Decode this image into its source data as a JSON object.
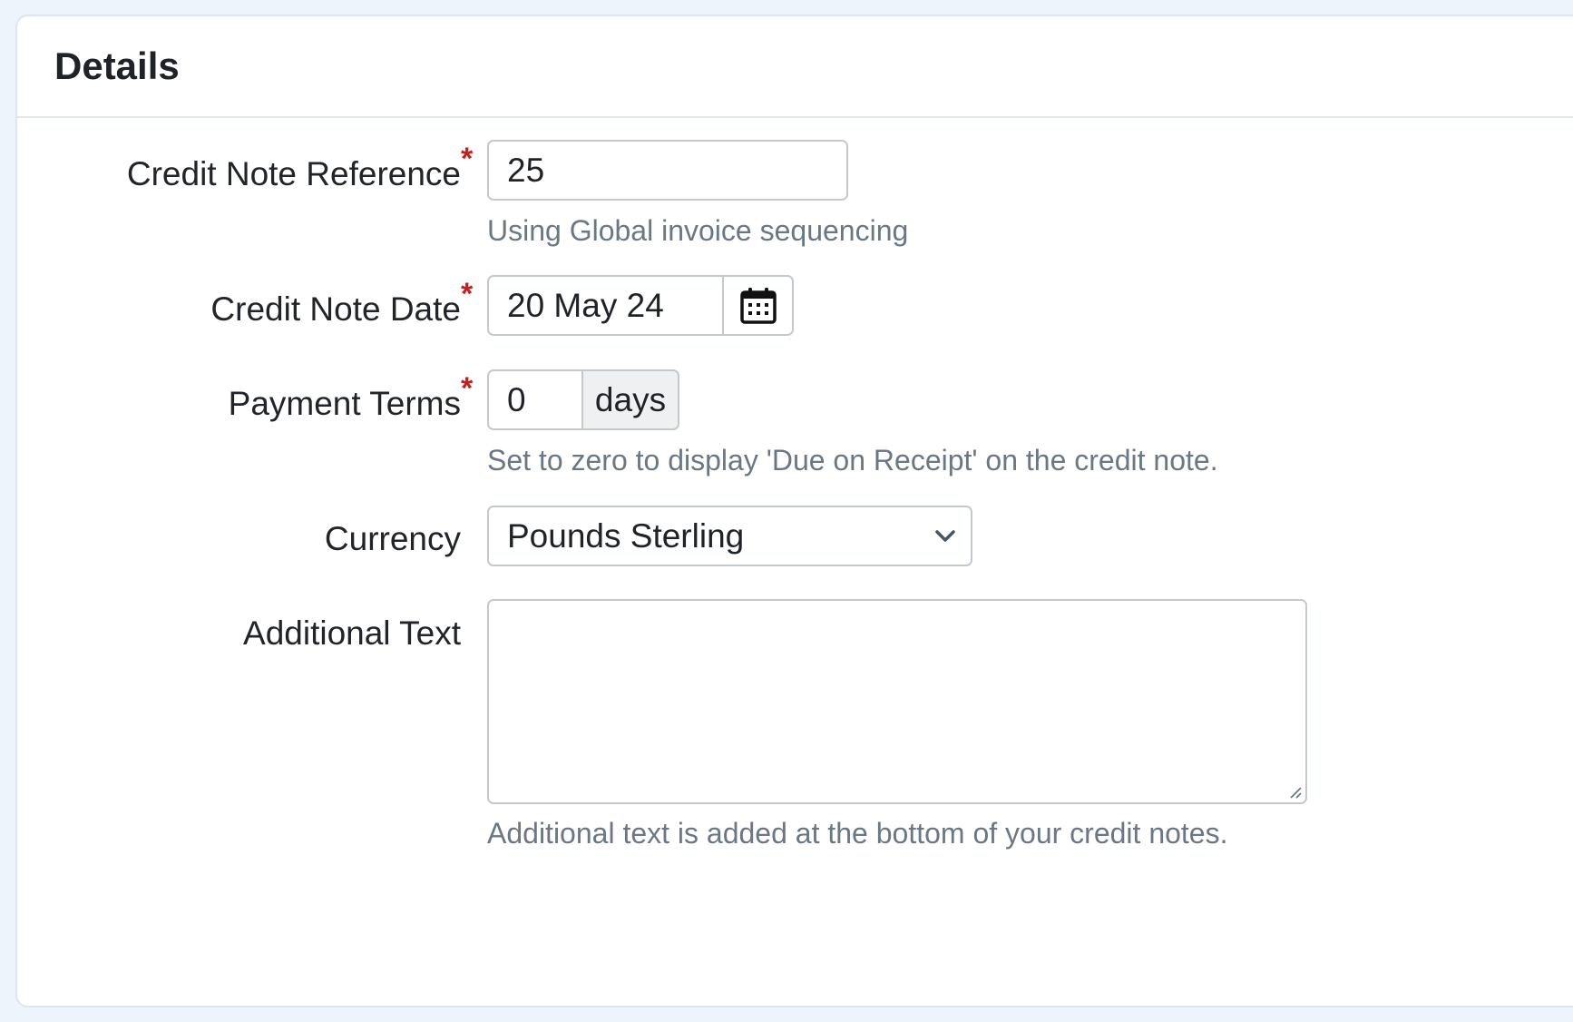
{
  "panel": {
    "title": "Details"
  },
  "form": {
    "reference": {
      "label": "Credit Note Reference",
      "required_mark": "*",
      "value": "25",
      "help": "Using Global invoice sequencing"
    },
    "date": {
      "label": "Credit Note Date",
      "required_mark": "*",
      "value": "20 May 24",
      "icon": "calendar-icon"
    },
    "payment_terms": {
      "label": "Payment Terms",
      "required_mark": "*",
      "value": "0",
      "unit": "days",
      "help": "Set to zero to display 'Due on Receipt' on the credit note."
    },
    "currency": {
      "label": "Currency",
      "selected": "Pounds Sterling",
      "icon": "chevron-down-icon"
    },
    "additional_text": {
      "label": "Additional Text",
      "value": "",
      "help": "Additional text is added at the bottom of your credit notes."
    }
  },
  "colors": {
    "required": "#c81e1e",
    "help_text": "#6b7784",
    "border": "#c3c9cf",
    "background": "#eef4fb"
  }
}
